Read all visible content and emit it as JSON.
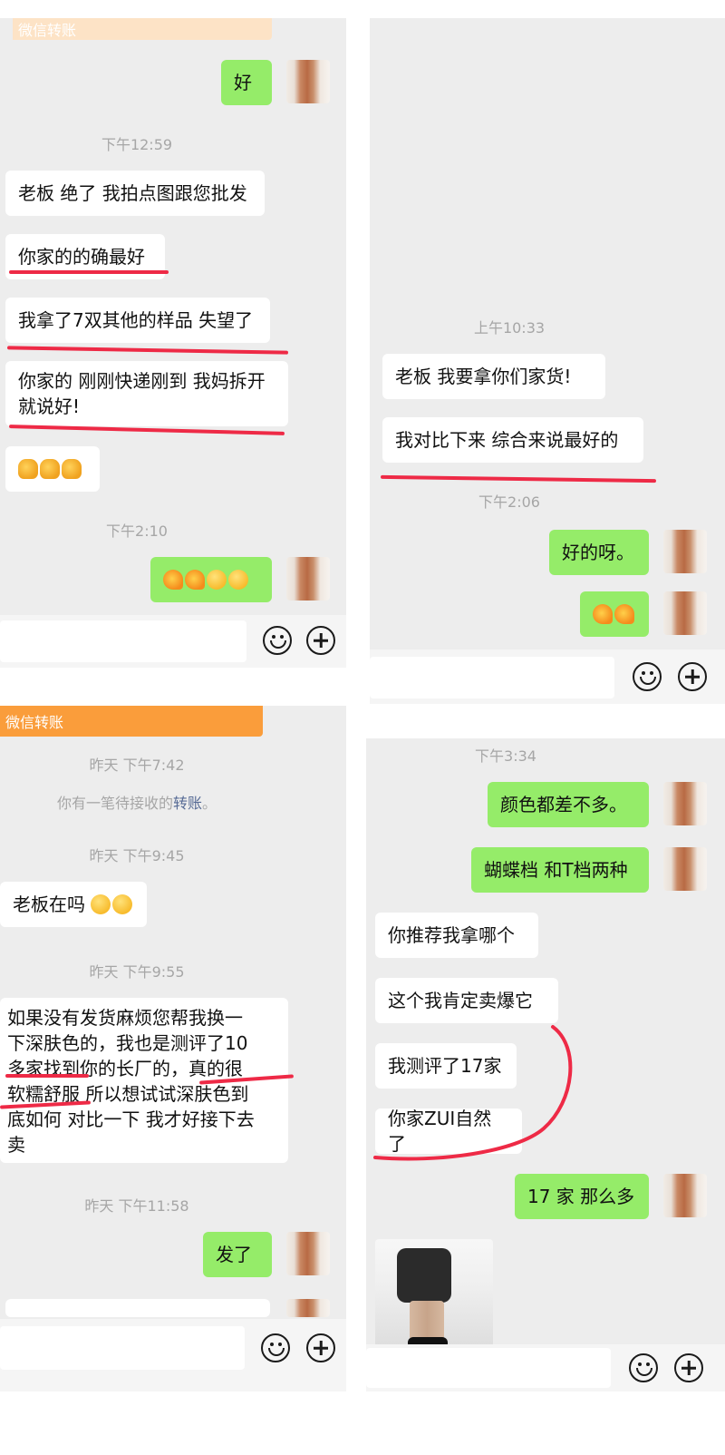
{
  "panel1": {
    "banner": "微信转账",
    "msgs": {
      "m1": "好",
      "t1": "下午12:59",
      "m2": "老板 绝了 我拍点图跟您批发",
      "m3": "你家的的确最好",
      "m4": "我拿了7双其他的样品 失望了",
      "m5_l1": "你家的 刚刚快递刚到 我妈拆开",
      "m5_l2": "就说好!",
      "t2": "下午2:10"
    }
  },
  "panel2": {
    "msgs": {
      "t1": "上午10:33",
      "m1": "老板 我要拿你们家货!",
      "m2": "我对比下来 综合来说最好的",
      "t2": "下午2:06",
      "m3": "好的呀。"
    }
  },
  "panel3": {
    "banner": "微信转账",
    "msgs": {
      "t1": "昨天 下午7:42",
      "sys_pre": "你有一笔待接收的",
      "sys_link": "转账",
      "sys_post": "。",
      "t2": "昨天 下午9:45",
      "m1": "老板在吗",
      "t3": "昨天 下午9:55",
      "m2_l1": "如果没有发货麻烦您帮我换一",
      "m2_l2": "下深肤色的，我也是测评了10",
      "m2_l3": "多家找到你的长厂的，真的很",
      "m2_l4": "软糯舒服 所以想试试深肤色到",
      "m2_l5": "底如何 对比一下 我才好接下去",
      "m2_l6": "卖",
      "t4": "昨天 下午11:58",
      "m3": "发了"
    }
  },
  "panel4": {
    "msgs": {
      "t1": "下午3:34",
      "m1": "颜色都差不多。",
      "m2": "蝴蝶档 和T档两种",
      "m3": "你推荐我拿哪个",
      "m4": "这个我肯定卖爆它",
      "m5": "我测评了17家",
      "m6": "你家ZUI自然了",
      "m7": "17 家 那么多"
    }
  },
  "icons": [
    "emoji-icon",
    "plus-icon",
    "thumbs-up-icon",
    "snail-emoji-icon",
    "face-emoji-icon"
  ],
  "colors": {
    "chat_bg": "#ededed",
    "outgoing_bubble": "#95ec69",
    "incoming_bubble": "#ffffff",
    "transfer_banner": "#fa9d3b",
    "annotation_red": "#ee2a46"
  }
}
